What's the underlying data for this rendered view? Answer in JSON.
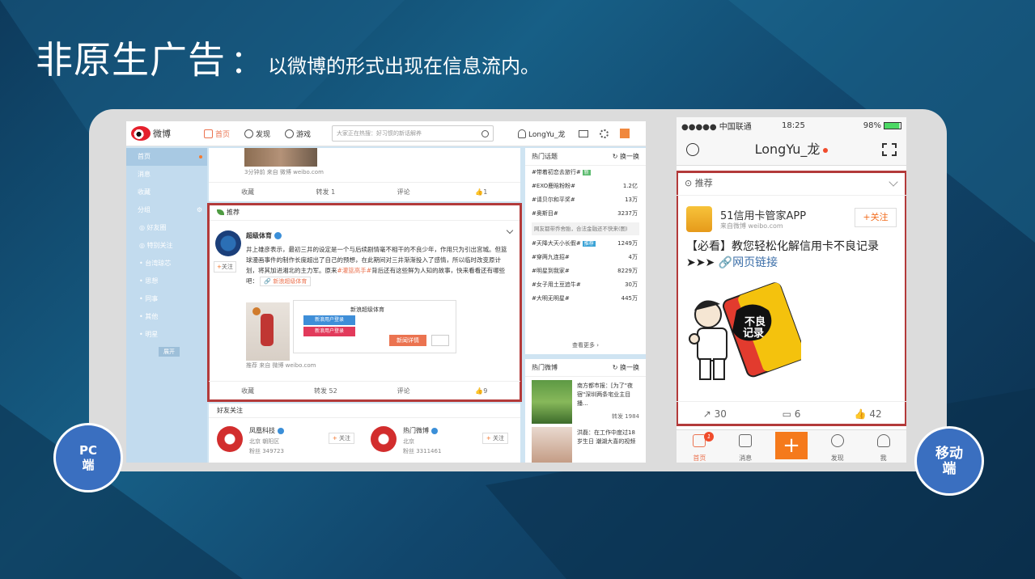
{
  "slide": {
    "title": "非原生广告",
    "colon": "：",
    "subtitle": "以微博的形式出现在信息流内。"
  },
  "pc": {
    "logo": "微博",
    "nav": [
      "首页",
      "发现",
      "游戏"
    ],
    "search_placeholder": "大家正在热搜：好习惯的新话解养",
    "username": "LongYu_龙",
    "sidebar": {
      "items": [
        "首页",
        "消息",
        "收藏",
        "分组"
      ],
      "subs": [
        "◎ 好友圈",
        "◎ 特别关注",
        "• 台湾琼芯",
        "• 思想",
        "• 同事",
        "• 其他",
        "• 明星"
      ],
      "expand": "展开"
    },
    "card1": {
      "meta": "3分钟前 来自 微博 weibo.com",
      "actions": [
        "收藏",
        "转发 1",
        "评论",
        "👍1"
      ]
    },
    "ad": {
      "header": "推荐",
      "name": "超级体育",
      "follow_plus": "+",
      "follow": "关注",
      "text1": "井上雄彦表示，最初三井的设定是一个与后续剧情毫不相干的不良少年，作用只为引出宫城。但篮球漫画事件的制作长度超出了自己的预想，在此期间对三井渐渐投入了感情，所以临时改变原计划，将其加进湘北的主力军。原来",
      "link": "#灌篮高手#",
      "text2": "背后还有这些鲜为人知的故事，快来看看还有哪些吧：",
      "tag": "🔗 新浪超级体育",
      "card_title": "新浪超级体育",
      "btn_login1": "新浪用户登录",
      "btn_login2": "新浪用户登录",
      "btn_detail": "新闻详情",
      "meta": "推荐 来自 微博 weibo.com",
      "actions": [
        "收藏",
        "转发 52",
        "评论",
        "👍9"
      ]
    },
    "friends": {
      "header": "好友关注",
      "f1": {
        "name": "凤凰科技",
        "loc": "北京 朝阳区",
        "fans": "粉丝 349723"
      },
      "f2": {
        "name": "热门微博",
        "loc": "北京",
        "fans": "粉丝 3311461"
      },
      "follow": "关注"
    },
    "hot_topics": {
      "title": "热门话题",
      "refresh": "换一换",
      "items": [
        {
          "t": "#带着初恋去旅行#",
          "badge": "新",
          "v": ""
        },
        {
          "t": "#EXO鹿晗粉粉#",
          "badge": "",
          "v": "1.2亿"
        },
        {
          "t": "#请贝尔和平奖#",
          "badge": "",
          "v": "13万"
        },
        {
          "t": "#奥斯目#",
          "badge": "",
          "v": "3237万"
        }
      ],
      "note": "网友都带乔舍胎，合法金融还不快来(图)",
      "items2": [
        {
          "t": "#天降大天小长假#",
          "badge": "推荐",
          "v": "1249万"
        },
        {
          "t": "#穿两九连招#",
          "badge": "",
          "v": "4万"
        },
        {
          "t": "#明星到我家#",
          "badge": "",
          "v": "8229万"
        },
        {
          "t": "#女子用土豆追牛#",
          "badge": "",
          "v": "30万"
        },
        {
          "t": "#大明无明星#",
          "badge": "",
          "v": "445万"
        }
      ],
      "more": "查看更多 ›"
    },
    "hot_weibo": {
      "title": "热门微博",
      "refresh": "换一换",
      "w1": "南方都市报：[为了\"夜宿\"深圳两条宅业主目播...",
      "w1_count": "转发 1984",
      "w2": "洪磊：在工作中度过18岁生日 潮湖大喜的视频"
    }
  },
  "mobile": {
    "carrier": "●●●●● 中国联通",
    "time": "18:25",
    "battery": "98%",
    "username": "LongYu_龙",
    "ad": {
      "header": "推荐",
      "app": "51信用卡管家APP",
      "from": "来自微博 weibo.com",
      "follow": "+关注",
      "text": "【必看】教您轻松化解信用卡不良记录",
      "link": "网页链接",
      "card_text": "不良记录",
      "actions": [
        "30",
        "6",
        "42"
      ]
    },
    "tabs": [
      "首页",
      "消息",
      "+",
      "发现",
      "我"
    ],
    "badge": "1"
  },
  "labels": {
    "pc_line1": "PC",
    "pc_line2": "端",
    "m_line1": "移动",
    "m_line2": "端"
  }
}
